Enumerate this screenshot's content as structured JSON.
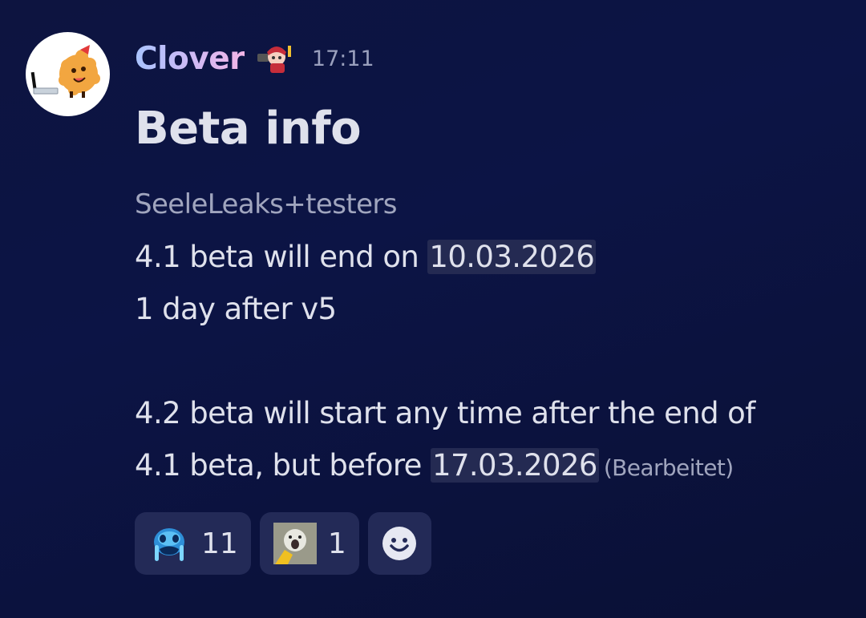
{
  "message": {
    "author": "Clover",
    "timestamp": "17:11",
    "title": "Beta info",
    "subtext": "SeeleLeaks+testers",
    "line1_prefix": "4.1 beta will end on ",
    "line1_date": "10.03.2026",
    "line2": "1 day after v5",
    "line3": "4.2 beta will start any time after the end of",
    "line4_prefix": "4.1 beta, but before ",
    "line4_date": "17.03.2026",
    "edited_label": "(Bearbeitet)"
  },
  "reactions": [
    {
      "emoji": "crying-blue-face-emoji",
      "count": "11"
    },
    {
      "emoji": "screaming-cat-emoji",
      "count": "1"
    }
  ],
  "add_reaction_icon": "smiley-icon",
  "colors": {
    "background": "#0c1445",
    "reaction_bg": "#232a57",
    "date_highlight": "#242a52",
    "username_gradient": [
      "#a9c4ff",
      "#f2b5e6"
    ]
  }
}
